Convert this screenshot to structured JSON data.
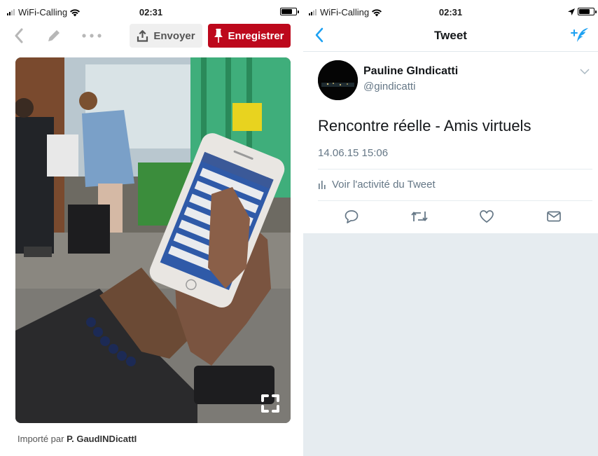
{
  "left_screen": {
    "status": {
      "carrier": "WiFi-Calling",
      "time": "02:31"
    },
    "toolbar": {
      "back_icon": "chevron-left-icon",
      "edit_icon": "pencil-icon",
      "more_icon": "ellipsis-icon",
      "send_label": "Envoyer",
      "send_icon": "share-upload-icon",
      "save_label": "Enregistrer",
      "save_icon": "pushpin-icon",
      "save_color": "#bd081c"
    },
    "photo": {
      "expand_icon": "fullscreen-icon"
    },
    "credit": {
      "prefix": "Importé par",
      "author": "P. GaudINDicattI"
    }
  },
  "right_screen": {
    "status": {
      "carrier": "WiFi-Calling",
      "time": "02:31"
    },
    "nav": {
      "title": "Tweet",
      "back_icon": "chevron-left-icon",
      "compose_icon": "compose-tweet-icon",
      "accent_color": "#1da1f2"
    },
    "tweet": {
      "author_name": "Pauline GIndicatti",
      "handle": "@gindicatti",
      "text": "Rencontre réelle - Amis virtuels",
      "timestamp": "14.06.15 15:06",
      "activity_label": "Voir l'activité du Tweet",
      "actions": [
        "reply-icon",
        "retweet-icon",
        "like-icon",
        "direct-message-icon"
      ]
    }
  }
}
